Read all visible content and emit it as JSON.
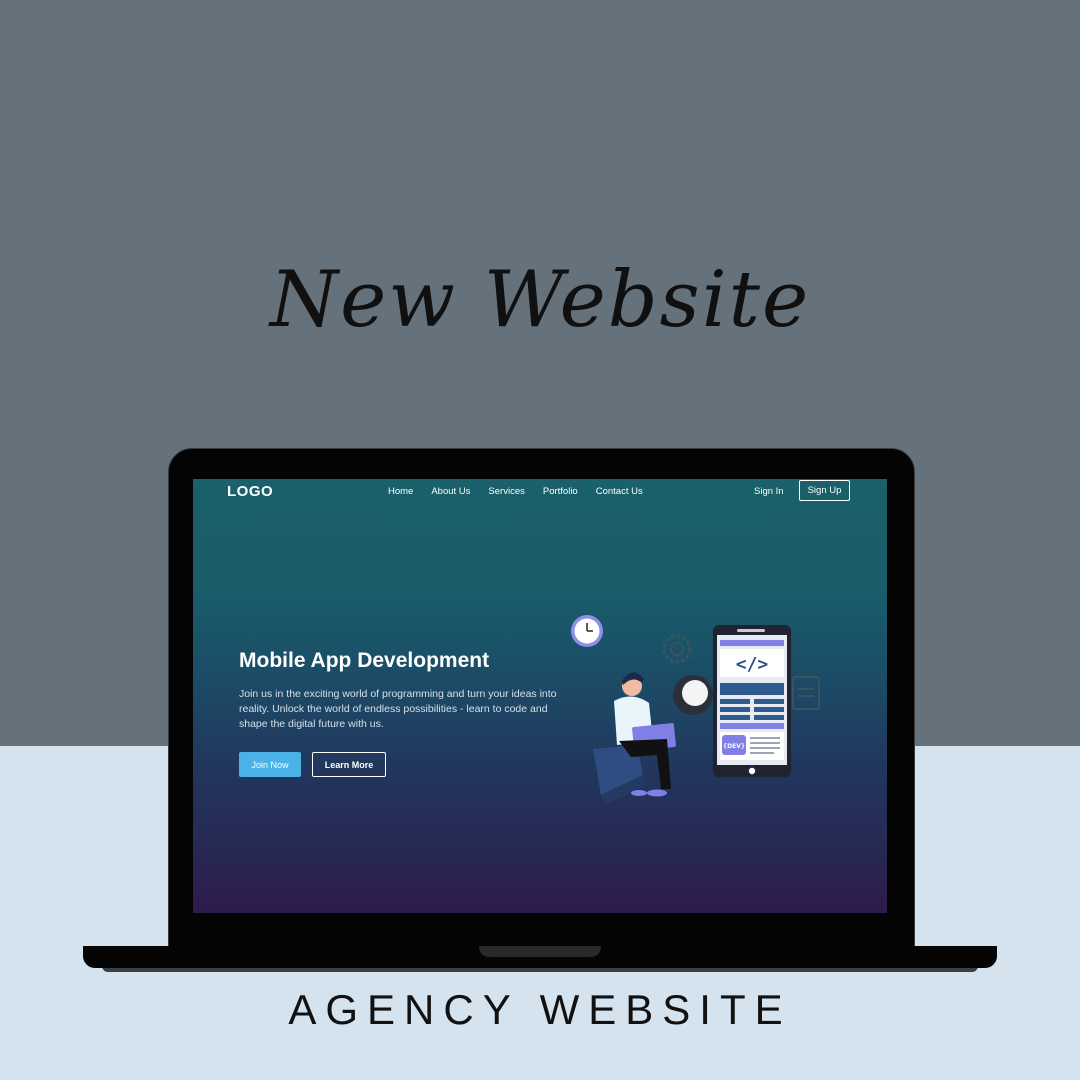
{
  "poster": {
    "headline": "New Website",
    "caption": "AGENCY WEBSITE"
  },
  "site": {
    "nav": {
      "logo": "LOGO",
      "links": [
        "Home",
        "About Us",
        "Services",
        "Portfolio",
        "Contact Us"
      ],
      "sign_in": "Sign In",
      "sign_up": "Sign Up"
    },
    "hero": {
      "title": "Mobile App Development",
      "description": "Join us in the exciting world of programming and turn your ideas into reality. Unlock the world of endless possibilities - learn to code and shape the digital future with us.",
      "primary_button": "Join Now",
      "secondary_button": "Learn More",
      "illustration_code_symbol": "</>",
      "illustration_badge": "{DEV}"
    }
  },
  "colors": {
    "poster_top": "#65717b",
    "poster_bottom": "#d5e3ef",
    "primary_button": "#4ab2e6",
    "accent_purple": "#7f7fe6"
  },
  "icons": [
    "clock-icon",
    "gear-icon",
    "code-icon",
    "document-icon"
  ]
}
